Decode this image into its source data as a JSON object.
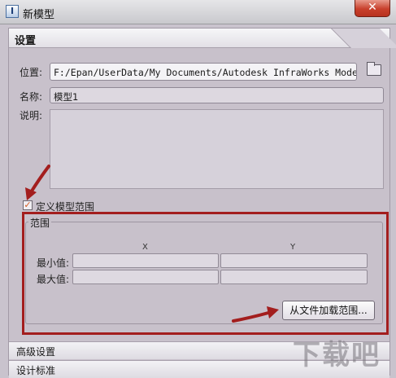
{
  "window": {
    "title": "新模型",
    "close_glyph": "✕",
    "app_icon_glyph": "I"
  },
  "settings": {
    "section_title": "设置",
    "location_label": "位置:",
    "location_value": "F:/Epan/UserData/My Documents/Autodesk InfraWorks Models/模型",
    "name_label": "名称:",
    "name_value": "模型1",
    "description_label": "说明:",
    "description_value": "",
    "define_extent_label": "定义模型范围",
    "define_extent_checked_glyph": "✓"
  },
  "extent": {
    "group_title": "范围",
    "col_x": "X",
    "col_y": "Y",
    "min_label": "最小值:",
    "max_label": "最大值:",
    "min_x": "",
    "min_y": "",
    "max_x": "",
    "max_y": "",
    "load_button": "从文件加载范围..."
  },
  "sections": {
    "advanced": "高级设置",
    "design_standard": "设计标准"
  },
  "icons": {
    "folder": "folder-icon",
    "close": "close-icon",
    "checkbox": "checkmark-icon"
  },
  "colors": {
    "annotation_red": "#a31e1e",
    "close_red": "#c8402c"
  },
  "watermark": "下载吧"
}
